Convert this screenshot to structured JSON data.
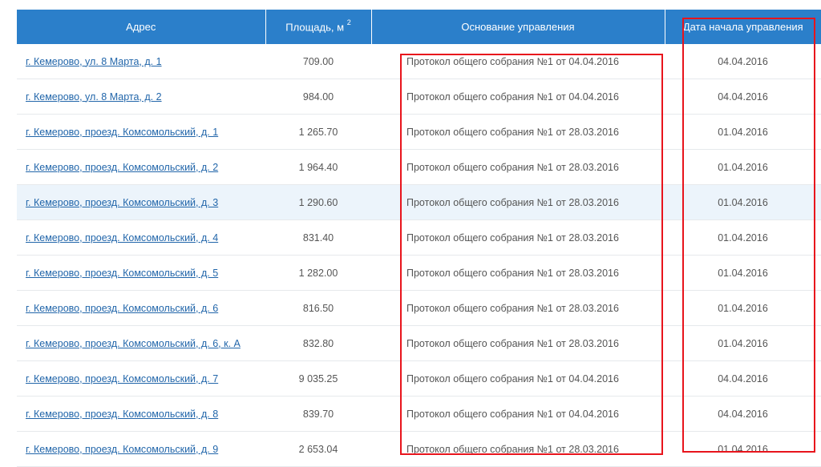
{
  "table": {
    "headers": {
      "address": "Адрес",
      "area": "Площадь, м",
      "area_sup": "2",
      "basis": "Основание управления",
      "start_date": "Дата начала управления"
    },
    "rows": [
      {
        "address": "г. Кемерово, ул. 8 Марта, д. 1",
        "area": "709.00",
        "basis": "Протокол общего собрания №1 от 04.04.2016",
        "date": "04.04.2016"
      },
      {
        "address": "г. Кемерово, ул. 8 Марта, д. 2",
        "area": "984.00",
        "basis": "Протокол общего собрания №1 от 04.04.2016",
        "date": "04.04.2016"
      },
      {
        "address": "г. Кемерово, проезд. Комсомольский, д. 1",
        "area": "1 265.70",
        "basis": "Протокол общего собрания №1 от 28.03.2016",
        "date": "01.04.2016"
      },
      {
        "address": "г. Кемерово, проезд. Комсомольский, д. 2",
        "area": "1 964.40",
        "basis": "Протокол общего собрания №1 от 28.03.2016",
        "date": "01.04.2016"
      },
      {
        "address": "г. Кемерово, проезд. Комсомольский, д. 3",
        "area": "1 290.60",
        "basis": "Протокол общего собрания №1 от 28.03.2016",
        "date": "01.04.2016"
      },
      {
        "address": "г. Кемерово, проезд. Комсомольский, д. 4",
        "area": "831.40",
        "basis": "Протокол общего собрания №1 от 28.03.2016",
        "date": "01.04.2016"
      },
      {
        "address": "г. Кемерово, проезд. Комсомольский, д. 5",
        "area": "1 282.00",
        "basis": "Протокол общего собрания №1 от 28.03.2016",
        "date": "01.04.2016"
      },
      {
        "address": "г. Кемерово, проезд. Комсомольский, д. 6",
        "area": "816.50",
        "basis": "Протокол общего собрания №1 от 28.03.2016",
        "date": "01.04.2016"
      },
      {
        "address": "г. Кемерово, проезд. Комсомольский, д. 6, к. А",
        "area": "832.80",
        "basis": "Протокол общего собрания №1 от 28.03.2016",
        "date": "01.04.2016"
      },
      {
        "address": "г. Кемерово, проезд. Комсомольский, д. 7",
        "area": "9 035.25",
        "basis": "Протокол общего собрания №1 от 04.04.2016",
        "date": "04.04.2016"
      },
      {
        "address": "г. Кемерово, проезд. Комсомольский, д. 8",
        "area": "839.70",
        "basis": "Протокол общего собрания №1 от 04.04.2016",
        "date": "04.04.2016"
      },
      {
        "address": "г. Кемерово, проезд. Комсомольский, д. 9",
        "area": "2 653.04",
        "basis": "Протокол общего собрания №1 от 28.03.2016",
        "date": "01.04.2016"
      }
    ],
    "highlighted_row": 4
  },
  "colors": {
    "header_bg": "#2b7fca",
    "link": "#2266aa",
    "annotation": "#e8141c",
    "row_highlight": "#ecf4fb"
  }
}
